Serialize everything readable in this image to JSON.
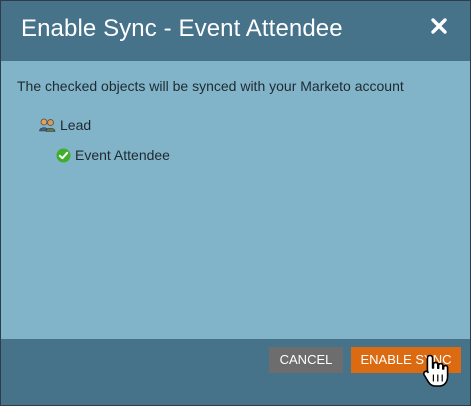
{
  "dialog": {
    "title": "Enable Sync - Event Attendee",
    "close_icon": "close-icon"
  },
  "body": {
    "intro_text": "The checked objects will be synced with your Marketo account",
    "tree": {
      "parent": {
        "label": "Lead",
        "icon": "people-icon"
      },
      "child": {
        "label": "Event Attendee",
        "icon": "check-circle-icon",
        "checked": true
      }
    }
  },
  "footer": {
    "cancel_label": "CANCEL",
    "enable_label": "ENABLE SYNC"
  },
  "colors": {
    "titlebar": "#46728a",
    "body": "#82b4c9",
    "cancel_button": "#6d6d6d",
    "enable_button": "#db6a10",
    "check": "#3fae2a"
  }
}
